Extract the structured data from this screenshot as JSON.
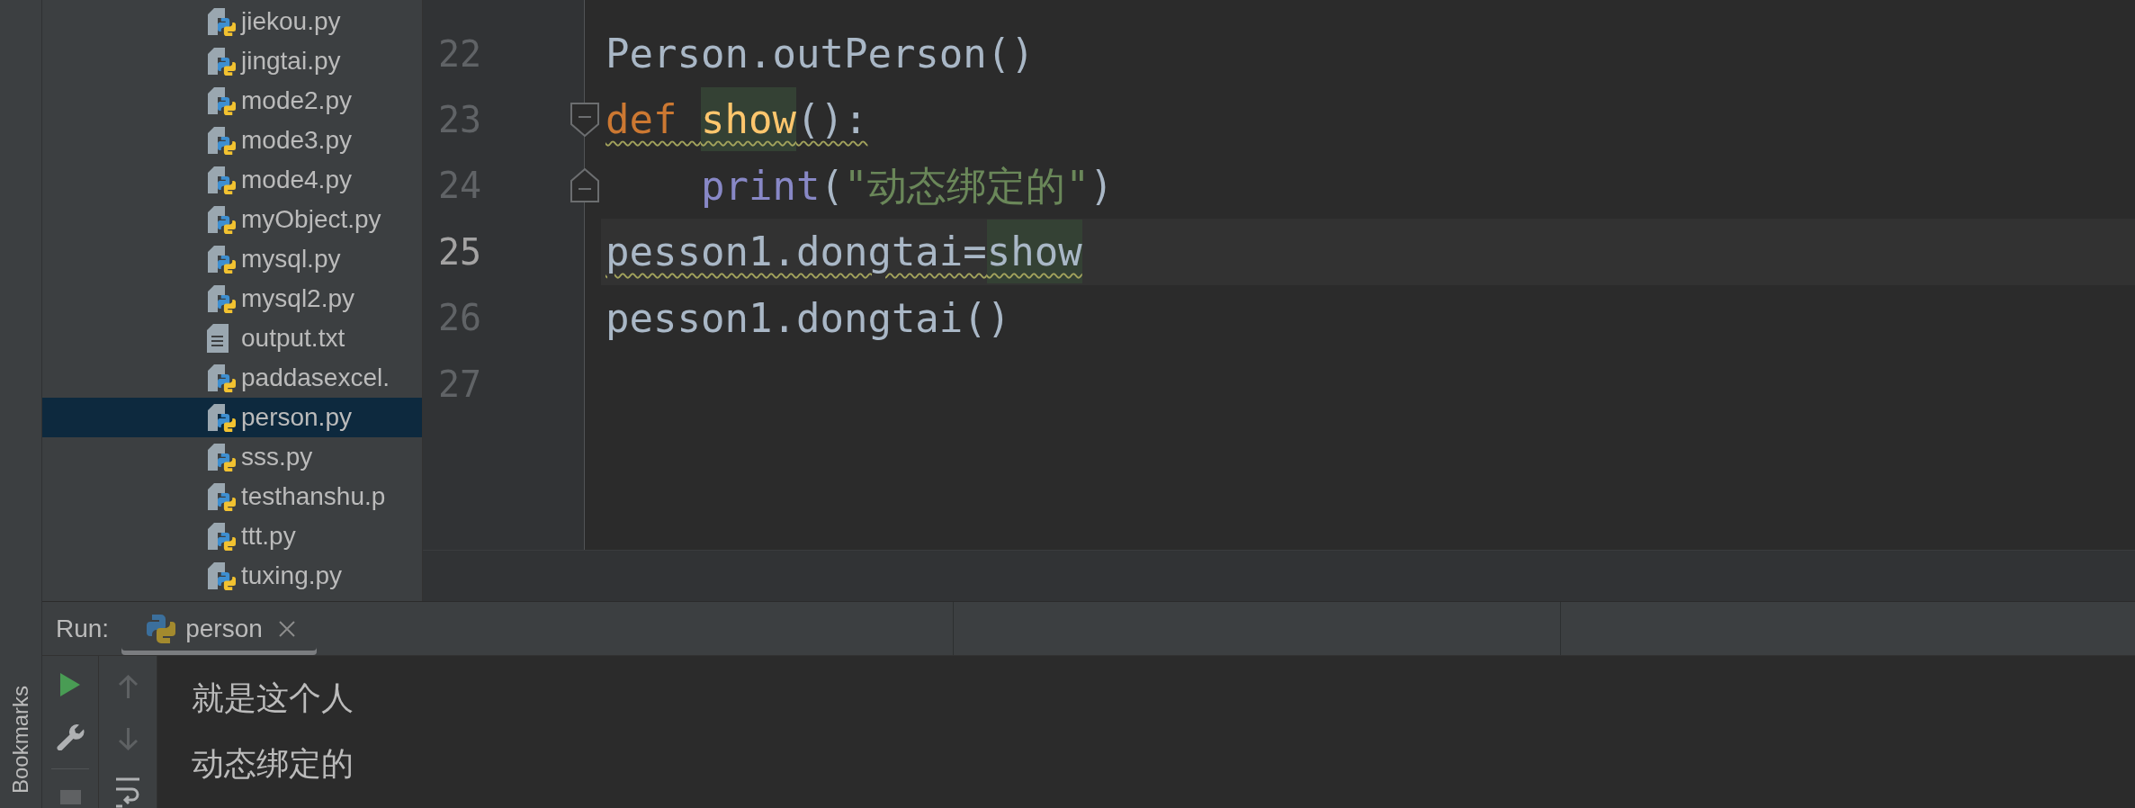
{
  "tool_strip": {
    "tabs": [
      {
        "label": "Bookmarks"
      }
    ]
  },
  "project_tree": {
    "items": [
      {
        "name": "jiekou.py",
        "kind": "python",
        "selected": false
      },
      {
        "name": "jingtai.py",
        "kind": "python",
        "selected": false
      },
      {
        "name": "mode2.py",
        "kind": "python",
        "selected": false
      },
      {
        "name": "mode3.py",
        "kind": "python",
        "selected": false
      },
      {
        "name": "mode4.py",
        "kind": "python",
        "selected": false
      },
      {
        "name": "myObject.py",
        "kind": "python",
        "selected": false
      },
      {
        "name": "mysql.py",
        "kind": "python",
        "selected": false
      },
      {
        "name": "mysql2.py",
        "kind": "python",
        "selected": false
      },
      {
        "name": "output.txt",
        "kind": "text",
        "selected": false
      },
      {
        "name": "paddasexcel.",
        "kind": "python",
        "selected": false
      },
      {
        "name": "person.py",
        "kind": "python",
        "selected": true
      },
      {
        "name": "sss.py",
        "kind": "python",
        "selected": false
      },
      {
        "name": "testhanshu.p",
        "kind": "python",
        "selected": false
      },
      {
        "name": "ttt.py",
        "kind": "python",
        "selected": false
      },
      {
        "name": "tuxing.py",
        "kind": "python",
        "selected": false
      }
    ]
  },
  "editor": {
    "lines": [
      {
        "number": "22",
        "kind": "plain",
        "current": false,
        "warning": false,
        "tokens": [
          {
            "text": "Person.outPerson()",
            "kind": "plain",
            "highlighted": false
          }
        ]
      },
      {
        "number": "23",
        "kind": "fold_start",
        "current": false,
        "warning": true,
        "tokens": [
          {
            "text": "def ",
            "kind": "keyword",
            "highlighted": false
          },
          {
            "text": "show",
            "kind": "function",
            "highlighted": true
          },
          {
            "text": "():",
            "kind": "plain",
            "highlighted": false
          }
        ],
        "children": [
          {
            "number": "24",
            "kind": "fold_end",
            "current": false,
            "warning": false,
            "tokens": [
              {
                "text": "print",
                "kind": "builtin",
                "highlighted": false
              },
              {
                "text": "(",
                "kind": "plain",
                "highlighted": false
              },
              {
                "text": "\"动态绑定的\"",
                "kind": "string",
                "highlighted": false
              },
              {
                "text": ")",
                "kind": "plain",
                "highlighted": false
              }
            ]
          }
        ]
      },
      {
        "number": "25",
        "kind": "plain",
        "current": true,
        "warning": true,
        "tokens": [
          {
            "text": "pesson1.dongtai=",
            "kind": "plain",
            "highlighted": false
          },
          {
            "text": "show",
            "kind": "plain",
            "highlighted": true
          }
        ]
      },
      {
        "number": "26",
        "kind": "plain",
        "current": false,
        "warning": false,
        "tokens": [
          {
            "text": "pesson1.dongtai()",
            "kind": "plain",
            "highlighted": false
          }
        ]
      },
      {
        "number": "27",
        "kind": "plain",
        "current": false
      }
    ]
  },
  "run_panel": {
    "title": "Run:",
    "tabs": [
      {
        "label": "person",
        "selected": true
      }
    ],
    "toolbar": [
      {
        "kind": "run",
        "disabled": false
      },
      {
        "kind": "settings",
        "disabled": false
      },
      {
        "kind": "stop",
        "disabled": true
      }
    ],
    "scroll_toolbar": [
      {
        "kind": "scroll_up",
        "disabled": true
      },
      {
        "kind": "scroll_down",
        "disabled": true
      },
      {
        "kind": "soft_wrap",
        "disabled": false
      }
    ],
    "output": [
      "就是这个人",
      "动态绑定的"
    ]
  }
}
